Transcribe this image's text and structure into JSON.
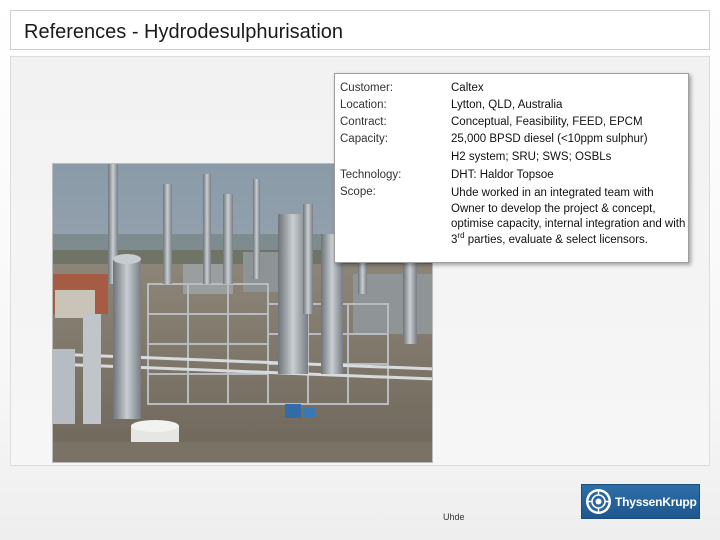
{
  "slide": {
    "title": "References - Hydrodesulphurisation"
  },
  "project": {
    "fields": [
      {
        "label": "Customer:",
        "value": "Caltex"
      },
      {
        "label": "Location:",
        "value": "Lytton, QLD, Australia"
      },
      {
        "label": "Contract:",
        "value": "Conceptual, Feasibility, FEED, EPCM"
      },
      {
        "label": "Capacity:",
        "value": "25,000 BPSD diesel (<10ppm sulphur)"
      },
      {
        "label": "",
        "value": "H2 system; SRU; SWS; OSBLs"
      },
      {
        "label": "Technology:",
        "value": "DHT: Haldor Topsoe"
      }
    ],
    "scope": {
      "label": "Scope:",
      "text_a": "Uhde worked in an integrated team with Owner to develop the project & concept, optimise capacity, internal integration and with 3",
      "sup": "rd",
      "text_b": " parties, evaluate & select licensors."
    }
  },
  "footer": {
    "brand": "Uhde",
    "logo_text": "ThyssenKrupp",
    "logo_icon": "thyssenkrupp-emblem"
  },
  "colors": {
    "logo_blue": "#2466a3",
    "title_text": "#1a1a1a"
  }
}
